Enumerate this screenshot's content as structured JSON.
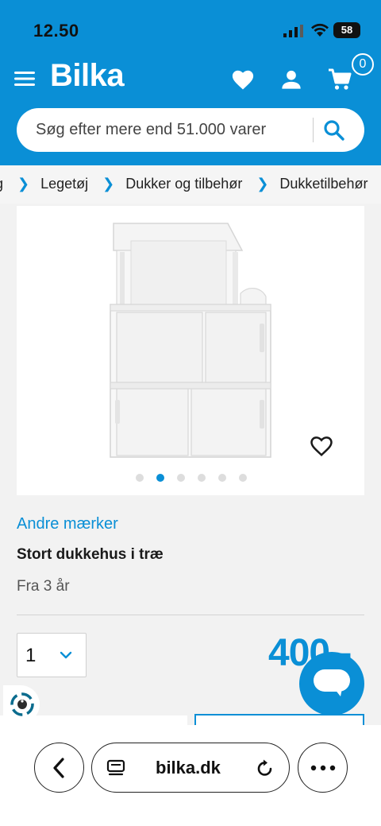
{
  "status": {
    "time": "12.50",
    "battery": "58"
  },
  "header": {
    "logo": "Bilka",
    "cart_count": "0",
    "brand_color": "#0a8fd6",
    "icons": [
      "menu-icon",
      "heart-icon",
      "user-icon",
      "cart-icon"
    ]
  },
  "search": {
    "placeholder": "Søg efter mere end 51.000 varer"
  },
  "breadcrumb": {
    "items": [
      "g",
      "Legetøj",
      "Dukker og tilbehør",
      "Dukketilbehør"
    ]
  },
  "gallery": {
    "slides": 6,
    "active_slide": 2
  },
  "product": {
    "brand": "Andre mærker",
    "title": "Stort dukkehus i træ",
    "age": "Fra 3 år",
    "quantity": "1",
    "price": "400,-"
  },
  "browser": {
    "url": "bilka.dk"
  }
}
